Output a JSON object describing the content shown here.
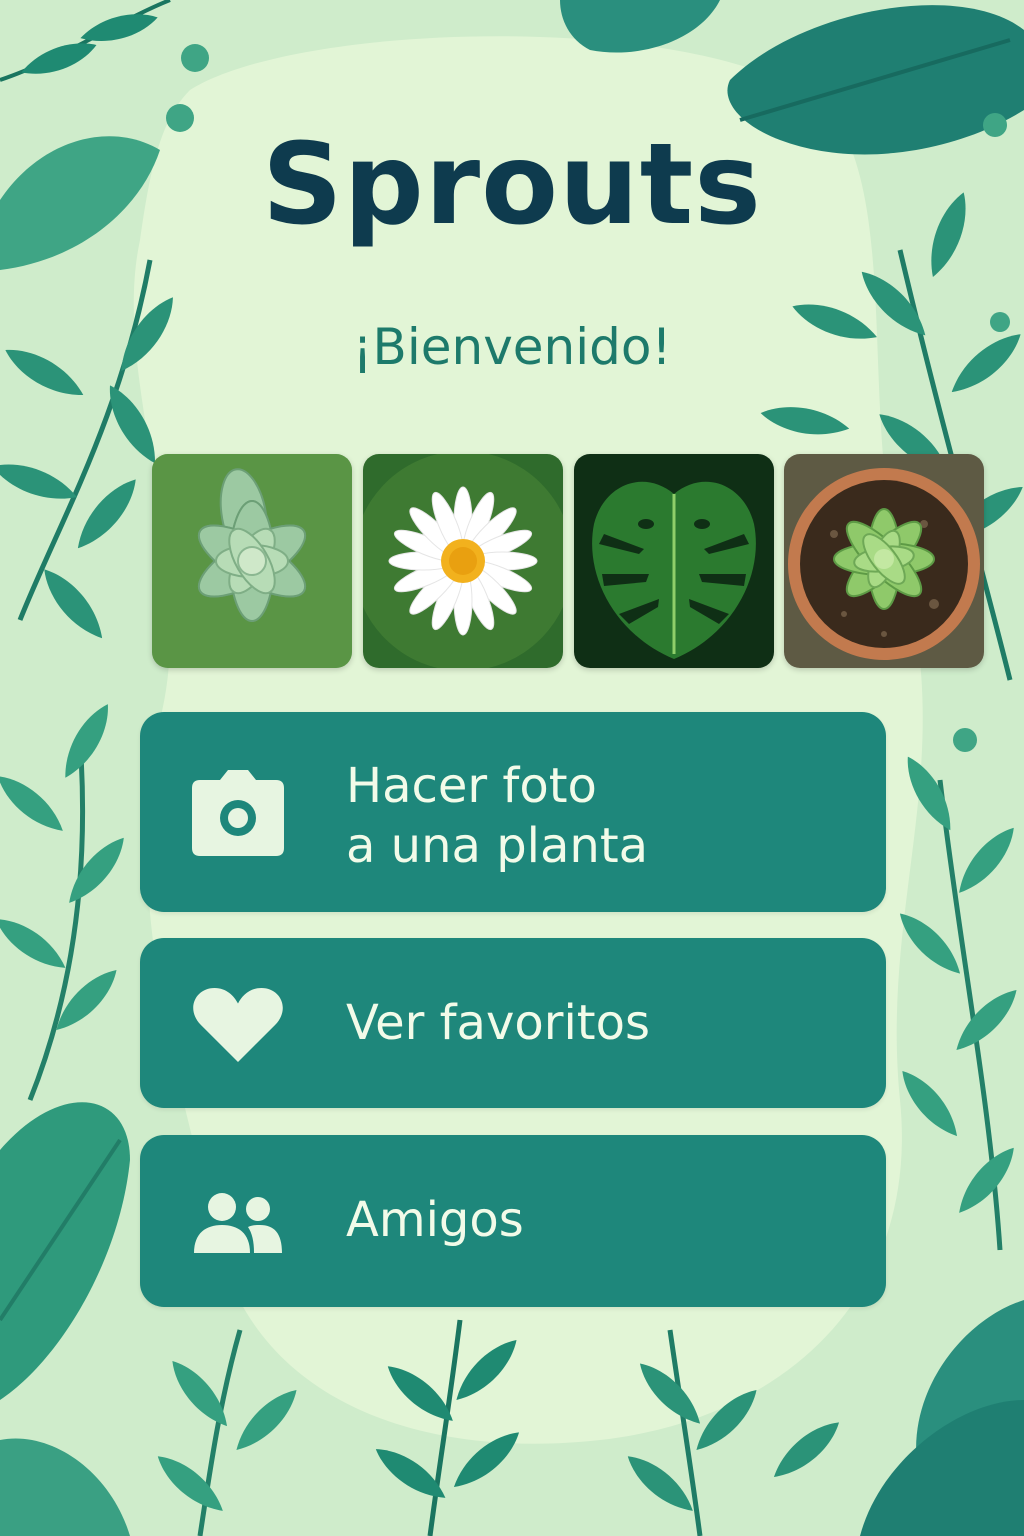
{
  "app": {
    "title": "Sprouts",
    "welcome": "¡Bienvenido!"
  },
  "gallery": [
    {
      "icon": "succulent-photo"
    },
    {
      "icon": "daisy-photo"
    },
    {
      "icon": "monstera-leaf-photo"
    },
    {
      "icon": "potted-succulent-photo"
    }
  ],
  "menu": {
    "photo_label": "Hacer foto\na una planta",
    "photo_icon": "camera-icon",
    "favorites_label": "Ver favoritos",
    "favorites_icon": "heart-icon",
    "friends_label": "Amigos",
    "friends_icon": "people-icon"
  },
  "colors": {
    "title": "#0e3b4e",
    "subtitle": "#1d7a6b",
    "button": "#1e877b",
    "button_text": "#f2fbe9",
    "background": "#cfeccb"
  }
}
